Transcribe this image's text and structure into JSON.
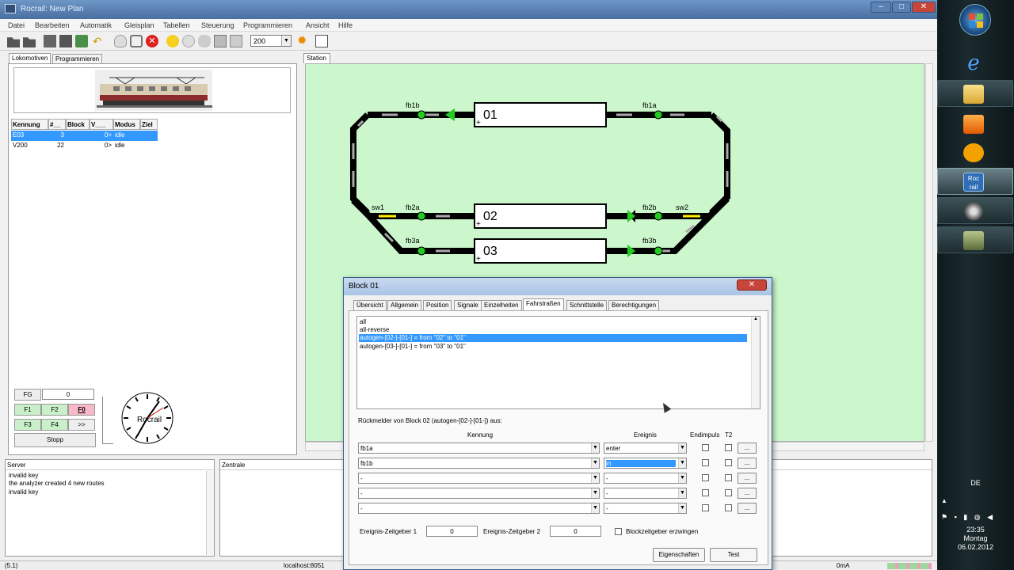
{
  "window": {
    "title": "Rocrail: New Plan",
    "minimize": "–",
    "maximize": "□",
    "close": "✕"
  },
  "menu": [
    "Datei",
    "Bearbeiten",
    "Automatik",
    "Gleisplan",
    "Tabellen",
    "Steuerung",
    "Programmieren",
    "Ansicht",
    "Hilfe"
  ],
  "toolbar": {
    "speed_value": "200"
  },
  "left_tabs": [
    "Lokomotiven",
    "Programmieren"
  ],
  "loco_table": {
    "columns": [
      "Kennung",
      "#__",
      "Block",
      "V___",
      "Modus",
      "Ziel"
    ],
    "rows": [
      {
        "id": "E03",
        "num": "3",
        "block": "",
        "v": "0>",
        "mode": "idle",
        "ziel": ""
      },
      {
        "id": "V200",
        "num": "22",
        "block": "",
        "v": "0>",
        "mode": "idle",
        "ziel": ""
      }
    ]
  },
  "functions": {
    "fg": "FG",
    "fg_value": "0",
    "f1": "F1",
    "f2": "F2",
    "f0": "F0",
    "f3": "F3",
    "f4": "F4",
    "more": ">>",
    "stop": "Stopp"
  },
  "clock": {
    "brand": "Rocrail"
  },
  "plan": {
    "tab": "Station",
    "blocks": [
      "01",
      "02",
      "03"
    ],
    "feedback_labels": {
      "fb1b": "fb1b",
      "fb1a": "fb1a",
      "sw1": "sw1",
      "fb2a": "fb2a",
      "fb2b": "fb2b",
      "sw2": "sw2",
      "fb3a": "fb3a",
      "fb3b": "fb3b"
    }
  },
  "server": {
    "header": "Server",
    "lines": [
      "invalid key",
      "the analyzer created 4 new routes",
      "invalid key"
    ]
  },
  "zentrale": {
    "header": "Zentrale"
  },
  "status": {
    "left": "(5.1)",
    "host": "localhost:8051",
    "current": "0mA"
  },
  "dialog": {
    "title": "Block 01",
    "close": "✕",
    "tabs": [
      "Übersicht",
      "Allgemein",
      "Position",
      "Signale",
      "Einzelheiten",
      "Fahrstraßen",
      "Schnittstelle",
      "Berechtigungen"
    ],
    "routes": [
      "all",
      "all-reverse",
      "autogen-[02-]-[01-] = from \"02\" to \"01\"",
      "autogen-[03-]-[01-] = from \"03\" to \"01\""
    ],
    "section_label": "Rückmelder von Block 02 (autogen-[02-]-[01-]) aus:",
    "col_kennung": "Kennung",
    "col_ereignis": "Ereignis",
    "col_endimpuls": "Endimpuls",
    "col_t2": "T2",
    "rows": [
      {
        "kennung": "fb1a",
        "ereignis": "enter"
      },
      {
        "kennung": "fb1b",
        "ereignis": "in"
      },
      {
        "kennung": "-",
        "ereignis": "-"
      },
      {
        "kennung": "-",
        "ereignis": "-"
      },
      {
        "kennung": "-",
        "ereignis": "-"
      }
    ],
    "dots": "...",
    "timer1_label": "Ereignis-Zeitgeber 1",
    "timer1_value": "0",
    "timer2_label": "Ereignis-Zeitgeber 2",
    "timer2_value": "0",
    "force_label": "Blockzeitgeber erzwingen",
    "btn_properties": "Eigenschaften",
    "btn_test": "Test"
  },
  "taskbar": {
    "rocrail_icon_line1": "Roc",
    "rocrail_icon_line2": "rail",
    "lang": "DE",
    "time": "23:35",
    "day": "Montag",
    "date": "06.02.2012"
  },
  "colors": {
    "plan_bg": "#ccf7cc",
    "selection": "#3399ff",
    "sensor_on": "#22cc22",
    "switch_yellow": "#ffee00"
  }
}
